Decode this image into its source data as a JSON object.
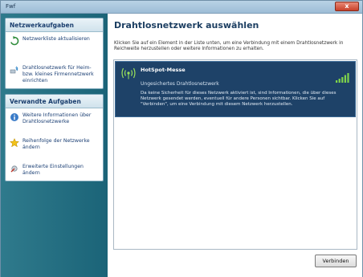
{
  "window": {
    "title": "Fwf",
    "close_label": "x"
  },
  "sidebar": {
    "network_tasks": {
      "header": "Netzwerkaufgaben",
      "items": [
        {
          "label": "Netzwerkliste aktualisieren",
          "icon": "refresh-icon"
        },
        {
          "label": "Drahtlosnetzwerk für Heim- bzw. kleines Firmennetzwerk einrichten",
          "icon": "network-setup-icon"
        }
      ]
    },
    "related_tasks": {
      "header": "Verwandte Aufgaben",
      "items": [
        {
          "label": "Weitere Informationen über Drahtlosnetzwerke",
          "icon": "info-icon"
        },
        {
          "label": "Reihenfolge der Netzwerke ändern",
          "icon": "star-icon"
        },
        {
          "label": "Erweiterte Einstellungen ändern",
          "icon": "settings-icon"
        }
      ]
    }
  },
  "main": {
    "heading": "Drahtlosnetzwerk auswählen",
    "description": "Klicken Sie auf ein Element in der Liste unten, um eine Verbindung mit einem Drahtlosnetzwerk in Reichweite herzustellen oder weitere Informationen zu erhalten.",
    "networks": [
      {
        "name": "HotSpot-Messe",
        "type": "Ungesichertes Drahtlosnetzwerk",
        "description": "Da keine Sicherheit für dieses Netzwerk aktiviert ist, sind Informationen, die über dieses Netzwerk gesendet werden, eventuell für andere Personen sichtbar. Klicken Sie auf \"Verbinden\", um eine Verbindung mit diesem Netzwerk herzustellen.",
        "signal_bars": 5
      }
    ],
    "connect_label": "Verbinden"
  },
  "colors": {
    "sidebar": "#1f687b",
    "selection": "#1e4268",
    "heading": "#1d3f62"
  }
}
